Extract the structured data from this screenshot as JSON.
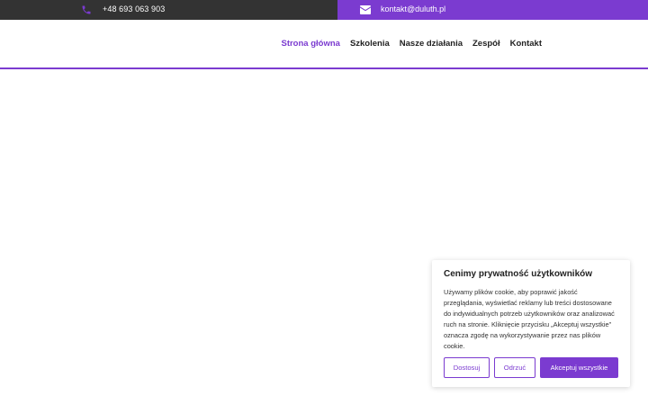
{
  "topbar": {
    "phone": "+48 693 063 903",
    "email": "kontakt@duluth.pl",
    "phone_icon": "phone-icon",
    "email_icon": "envelope-icon"
  },
  "nav": {
    "items": [
      {
        "label": "Strona główna",
        "active": true
      },
      {
        "label": "Szkolenia",
        "active": false
      },
      {
        "label": "Nasze działania",
        "active": false
      },
      {
        "label": "Zespół",
        "active": false
      },
      {
        "label": "Kontakt",
        "active": false
      }
    ]
  },
  "cookie": {
    "title": "Cenimy prywatność użytkowników",
    "text": "Używamy plików cookie, aby poprawić jakość przeglądania, wyświetlać reklamy lub treści dostosowane do indywidualnych potrzeb użytkowników oraz analizować ruch na stronie. Kliknięcie przycisku „Akceptuj wszystkie” oznacza zgodę na wykorzystywanie przez nas plików cookie.",
    "customize_label": "Dostosuj",
    "reject_label": "Odrzuć",
    "accept_label": "Akceptuj wszystkie"
  },
  "colors": {
    "accent": "#7b3bd0",
    "topbar_dark": "#333333"
  }
}
